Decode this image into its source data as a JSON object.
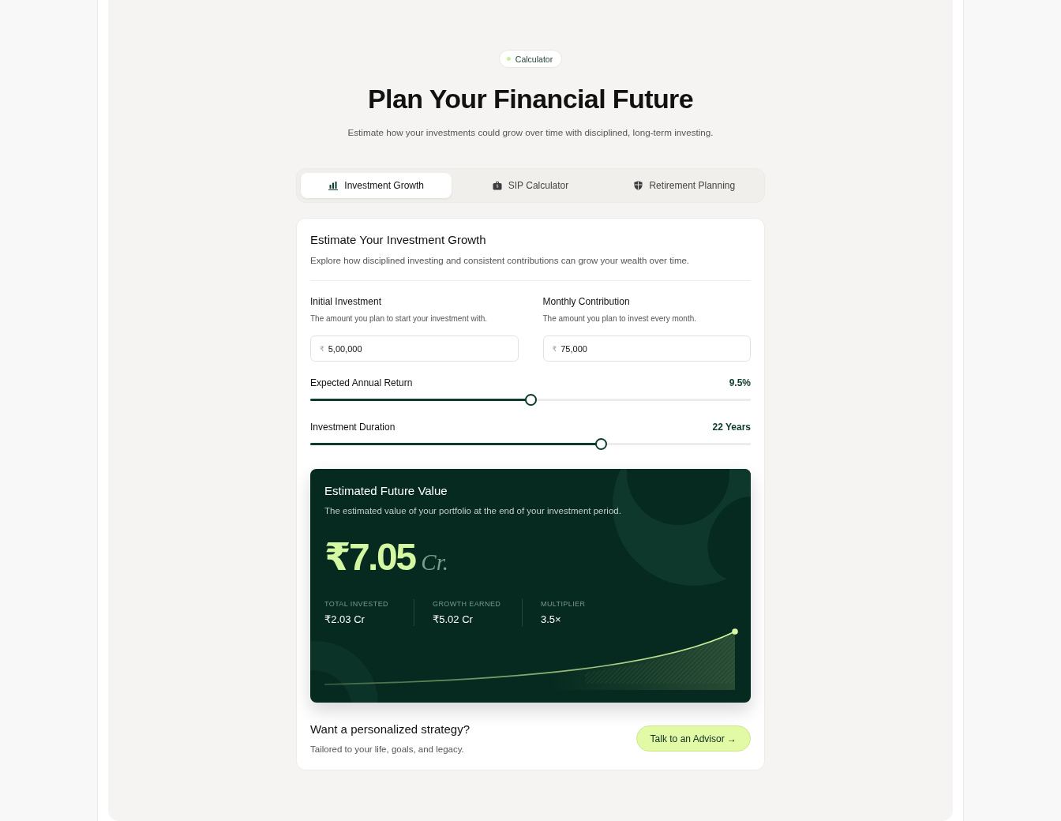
{
  "badge": {
    "label": "Calculator"
  },
  "header": {
    "title": "Plan Your Financial Future",
    "subtitle": "Estimate how your investments could grow over time with disciplined, long-term investing."
  },
  "tabs": [
    {
      "label": "Investment Growth",
      "selected": true
    },
    {
      "label": "SIP Calculator",
      "selected": false
    },
    {
      "label": "Retirement Planning",
      "selected": false
    }
  ],
  "calculator": {
    "title": "Estimate Your Investment Growth",
    "description": "Explore how disciplined investing and consistent contributions can grow your wealth over time.",
    "fields": [
      {
        "label": "Initial Investment",
        "hint": "The amount you plan to start your investment with.",
        "prefix": "₹",
        "value": "5,00,000"
      },
      {
        "label": "Monthly Contribution",
        "hint": "The amount you plan to invest every month.",
        "prefix": "₹",
        "value": "75,000"
      }
    ],
    "sliders": [
      {
        "label": "Expected Annual Return",
        "reading": "9.5%",
        "level": 0.5
      },
      {
        "label": "Investment Duration",
        "reading": "22 Years",
        "level": 0.66
      }
    ],
    "result": {
      "title": "Estimated Future Value",
      "description": "The estimated value of your portfolio at the end of your investment period.",
      "amount": "₹7.05",
      "unit": "Cr.",
      "stats": [
        {
          "label": "TOTAL INVESTED",
          "value": "₹2.03 Cr"
        },
        {
          "label": "GROWTH EARNED",
          "value": "₹5.02 Cr"
        },
        {
          "label": "MULTIPLIER",
          "value": "3.5×"
        }
      ]
    },
    "cta": {
      "title": "Want a personalized strategy?",
      "subtitle": "Tailored to your life, goals, and legacy.",
      "button": "Talk to an Advisor →"
    }
  }
}
